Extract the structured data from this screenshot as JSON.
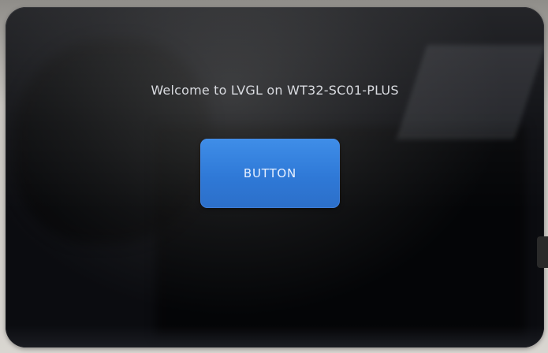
{
  "screen": {
    "welcome_text": "Welcome to LVGL on WT32-SC01-PLUS",
    "button_label": "BUTTON"
  },
  "colors": {
    "screen_background": "#0b0c10",
    "button": "#2f79d7",
    "text": "#d9dbe0"
  }
}
